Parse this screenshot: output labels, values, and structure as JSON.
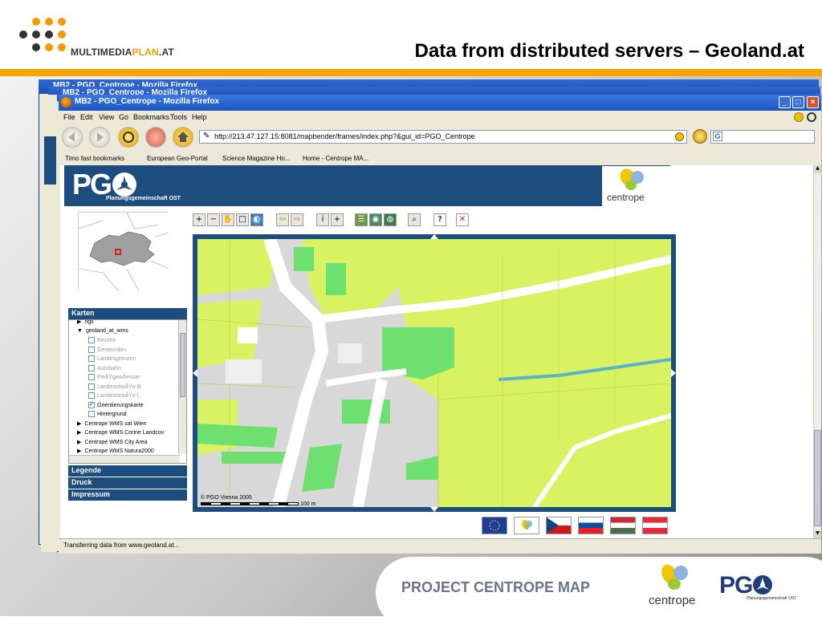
{
  "slide": {
    "title": "Data from distributed servers – Geoland.at",
    "logo_text_a": "MULTIMEDIA",
    "logo_text_b": "PLAN",
    "logo_text_c": ".AT",
    "footer_label": "PROJECT CENTROPE MAP",
    "footer_centrope": "centrope",
    "footer_pgo": "PG",
    "footer_pgo_sub": "Planungsgemeinschaft OST",
    "accent_orange": "#f7a600"
  },
  "back_windows": [
    {
      "title": "MB2 - PGO_Centrope - Mozilla Firefox"
    },
    {
      "title": "MB2 - PGO_Centrope - Mozilla Firefox"
    }
  ],
  "window": {
    "title": "MB2 - PGO_Centrope - Mozilla Firefox"
  },
  "menu": [
    "File",
    "Edit",
    "View",
    "Go",
    "Bookmarks",
    "Tools",
    "Help"
  ],
  "address": {
    "url": "http://213.47.127.15:8081/mapbender/frames/index.php?&gui_id=PGO_Centrope",
    "search_letter": "G"
  },
  "bookmarks": [
    "Timo fast bookmarks",
    "European Geo-Portal",
    "Science Magazine Ho...",
    "Home - Centrope MA..."
  ],
  "status": "Transferring data from www.geoland.at...",
  "app": {
    "pgo_logo": "PG",
    "pgo_sub": "Planungsgemeinschaft OST",
    "centrope_text": "centrope",
    "map_copyright": "© PGO Vienna 2005",
    "scale_label": "100 m"
  },
  "panel": {
    "karten": "Karten",
    "legende": "Legende",
    "druck": "Druck",
    "impressum": "Impressum",
    "tree": [
      {
        "label": "ngs",
        "type": "arrow",
        "gray": false
      },
      {
        "label": "geoland_at_wms",
        "type": "arrow-down",
        "gray": false
      },
      {
        "label": "Bezirke",
        "type": "cb",
        "checked": false,
        "gray": true
      },
      {
        "label": "Gemeinden",
        "type": "cb",
        "checked": false,
        "gray": true
      },
      {
        "label": "Landesgrenzen",
        "type": "cb",
        "checked": false,
        "gray": true
      },
      {
        "label": "Autobahn",
        "type": "cb",
        "checked": false,
        "gray": true
      },
      {
        "label": "FleÃŸgewÃ¤sser",
        "type": "cb",
        "checked": false,
        "gray": true
      },
      {
        "label": "LandesstraÃŸe B",
        "type": "cb",
        "checked": false,
        "gray": true
      },
      {
        "label": "LandesstraÃŸe L",
        "type": "cb",
        "checked": false,
        "gray": true
      },
      {
        "label": "Orientierungskarte",
        "type": "cb",
        "checked": true,
        "gray": false
      },
      {
        "label": "Hintergrund",
        "type": "cb",
        "checked": false,
        "gray": false
      },
      {
        "label": "Centrope WMS sat Wien",
        "type": "arrow",
        "gray": false
      },
      {
        "label": "Centrope WMS Corine Landcov",
        "type": "arrow",
        "gray": false
      },
      {
        "label": "Centrope WMS City Area",
        "type": "arrow",
        "gray": false
      },
      {
        "label": "Centrope WMS Natura2000",
        "type": "arrow",
        "gray": false
      }
    ]
  },
  "icons": {
    "check": "✓",
    "help": "?",
    "close": "✕",
    "arrow_right": "▶",
    "arrow_down": "▼"
  }
}
